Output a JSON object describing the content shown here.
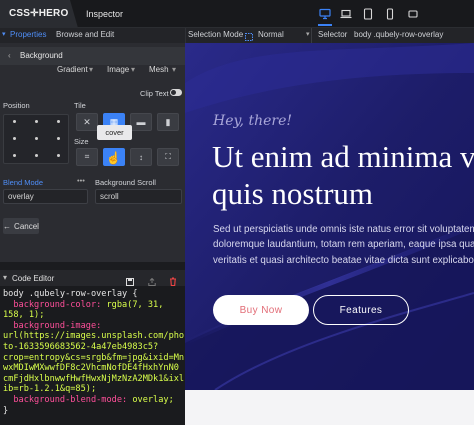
{
  "topbar": {
    "logo": "CSS✛HERO",
    "inspector_tab": "Inspector",
    "device_icons": [
      "desktop-icon",
      "laptop-icon",
      "tablet-icon",
      "phone-icon",
      "small-phone-icon"
    ]
  },
  "propbar": {
    "properties_label": "Properties",
    "browse_label": "Browse and Edit"
  },
  "selbar": {
    "selection_mode_label": "Selection Mode",
    "selection_mode_value": "Normal",
    "selector_label": "Selector",
    "selector_value": "body .qubely-row-overlay"
  },
  "background": {
    "header": "Background",
    "gradient": "Gradient",
    "image": "Image",
    "mesh": "Mesh",
    "clip_text": "Clip Text",
    "position_label": "Position",
    "tile_label": "Tile",
    "size_label": "Size",
    "tooltip": "cover",
    "blend_mode_label": "Blend Mode",
    "blend_mode_value": "overlay",
    "scroll_label": "Background Scroll",
    "scroll_value": "scroll",
    "cancel_label": "Cancel"
  },
  "editor": {
    "title": "Code Editor",
    "lines": [
      {
        "t": "sel",
        "text": "body .qubely-row-overlay {"
      },
      {
        "t": "decl",
        "prop": "  background-color:",
        "val": " rgba(7, 31,"
      },
      {
        "t": "val",
        "text": "158, 1);"
      },
      {
        "t": "decl",
        "prop": "  background-image:",
        "val": ""
      },
      {
        "t": "val",
        "text": "url(https://images.unsplash.com/pho"
      },
      {
        "t": "val",
        "text": "to-1633596683562-4a47eb4983c5?"
      },
      {
        "t": "val",
        "text": "crop=entropy&cs=srgb&fm=jpg&ixid=Mn"
      },
      {
        "t": "val",
        "text": "wxMDIwMXwwfDF8c2VhcmNofDE4fHxhYnN0"
      },
      {
        "t": "val",
        "text": "cmFjdHxlbnwwfHwfHwxNjMzNzA2MDk1&ixl"
      },
      {
        "t": "val",
        "text": "ib=rb-1.2.1&q=85);"
      },
      {
        "t": "decl",
        "prop": "  background-blend-mode:",
        "val": " overlay;"
      },
      {
        "t": "sel",
        "text": "}"
      }
    ]
  },
  "hero": {
    "kicker": "Hey, there!",
    "title": "Ut enim ad minima ve\nquis nostrum",
    "body": "Sed ut perspiciatis unde omnis iste natus error sit voluptatem\ndoloremque laudantium, totam rem aperiam, eaque ipsa quae\nveritatis et quasi architecto beatae vitae dicta sunt explicabo",
    "buy_button": "Buy Now",
    "features_button": "Features"
  },
  "colors": {
    "accent": "#3b82f6",
    "hero_bg": "#1f1f6e",
    "code_prop": "#ff4f9a",
    "code_val": "#d9ff4b"
  }
}
